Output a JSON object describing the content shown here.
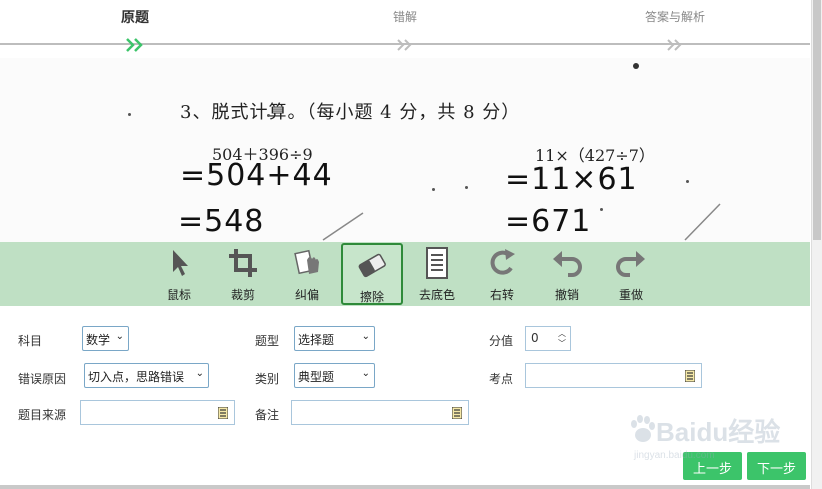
{
  "steps": [
    {
      "label": "原题",
      "active": true
    },
    {
      "label": "错解",
      "active": false
    },
    {
      "label": "答案与解析",
      "active": false
    }
  ],
  "photo": {
    "heading": "3、脱式计算。（每小题 4 分，共 8 分）",
    "left_expression": "504＋396÷9",
    "right_expression": "11×（427÷7）",
    "handwriting": [
      "=504+44",
      "=548",
      "=11×61",
      "=671"
    ]
  },
  "toolbar": {
    "tools": [
      {
        "label": "鼠标",
        "icon": "cursor-icon"
      },
      {
        "label": "裁剪",
        "icon": "crop-icon"
      },
      {
        "label": "纠偏",
        "icon": "deskew-icon"
      },
      {
        "label": "擦除",
        "icon": "eraser-icon",
        "active": true
      },
      {
        "label": "去底色",
        "icon": "remove-background-icon"
      },
      {
        "label": "右转",
        "icon": "rotate-right-icon"
      },
      {
        "label": "撤销",
        "icon": "undo-icon"
      },
      {
        "label": "重做",
        "icon": "redo-icon"
      }
    ]
  },
  "form": {
    "subject_label": "科目",
    "subject_value": "数学",
    "type_label": "题型",
    "type_value": "选择题",
    "score_label": "分值",
    "score_value": "0",
    "reason_label": "错误原因",
    "reason_value": "切入点，思路错误",
    "category_label": "类别",
    "category_value": "典型题",
    "point_label": "考点",
    "source_label": "题目来源",
    "note_label": "备注"
  },
  "buttons": {
    "prev": "上一步",
    "next": "下一步"
  },
  "watermark": {
    "text": "Baidu经验",
    "sub": "jingyan.baidu.com"
  },
  "colors": {
    "accent": "#3cc46a",
    "toolbar_bg": "#bfe0c4",
    "active_border": "#2f8a3a"
  }
}
